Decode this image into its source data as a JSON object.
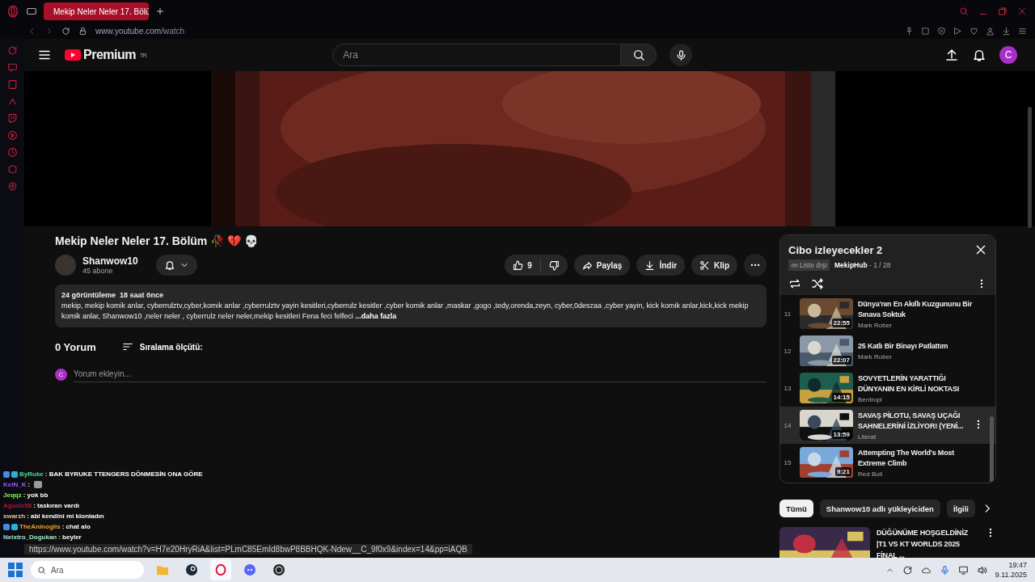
{
  "browser": {
    "tab_title": "Mekip Neler Neler 17. Bölü",
    "url_host": "www.youtube.com",
    "url_path": "/watch"
  },
  "header": {
    "logo_text": "Premium",
    "region": "TR",
    "search": {
      "placeholder": "Ara"
    },
    "avatar_letter": "C"
  },
  "video": {
    "title": "Mekip Neler Neler 17. Bölüm 🥀 💔 💀",
    "channel": "Shanwow10",
    "subscribers": "45 abone",
    "likes": "9",
    "actions": [
      {
        "kind": "share",
        "label": "Paylaş"
      },
      {
        "kind": "download",
        "label": "İndir"
      },
      {
        "kind": "clip",
        "label": "Klip"
      }
    ],
    "stats": "24 görüntüleme  18 saat önce",
    "description": "mekip, mekip komik anlar, cyberrulztv,cyber,komik anlar ,cyberrulztv yayin kesitleri,cyberrulz kesitler ,cyber komik anlar ,maskar ,gogo ,tedy,orenda,zeyn, cyber,0deszaa ,cyber yayin, kick komik anlar,kick,kick mekip komik anlar, Shanwow10 ,neler neler , cyberrulz neler neler,mekip kesitleri Fena feci felfeci ",
    "more": "...daha fazla"
  },
  "comments": {
    "count": "0 Yorum",
    "sort": "Sıralama ölçütü:",
    "placeholder": "Yorum ekleyin...",
    "avatar_letter": "C"
  },
  "playlist": {
    "title": "Cibo izleyecekler 2",
    "visibility": "Liste dışı",
    "owner": "MekipHub",
    "position": " - 1 / 28",
    "items": [
      {
        "index": "11",
        "title": "Dünya'nın En Akıllı Kuzgununu Bir Sınava Soktuk",
        "channel": "Mark Rober",
        "duration": "22:55",
        "selected": false
      },
      {
        "index": "12",
        "title": "25 Katlı Bir Binayı Patlattım",
        "channel": "Mark Rober",
        "duration": "22:07",
        "selected": false
      },
      {
        "index": "13",
        "title": "SOVYETLERİN YARATTIĞI DÜNYANIN EN KİRLİ NOKTASI",
        "channel": "Bentropi",
        "duration": "14:15",
        "selected": false
      },
      {
        "index": "14",
        "title": "SAVAŞ PİLOTU, SAVAŞ UÇAĞI SAHNELERİNİ İZLİYOR! (YENİ...",
        "channel": "Literat",
        "duration": "13:59",
        "selected": true
      },
      {
        "index": "15",
        "title": "Attempting The World's Most Extreme Climb",
        "channel": "Red Bull",
        "duration": "9:21",
        "selected": false
      }
    ]
  },
  "chips": [
    {
      "label": "Tümü",
      "selected": true
    },
    {
      "label": "Shanwow10 adlı yükleyiciden",
      "selected": false
    },
    {
      "label": "İlgili",
      "selected": false
    }
  ],
  "recommended": [
    {
      "title": "DÜĞÜNÜME HOŞGELDİNİZ |T1 VS KT WORLDS 2025 FİNAL ..."
    }
  ],
  "chat": [
    {
      "user": "ByRuke",
      "color": "#3ddc97",
      "message": " : BAK BYRUKE TTENGERS DÖNMESİN ONA GÖRE",
      "badges": true,
      "emote": false
    },
    {
      "user": "KeiN_K",
      "color": "#9b5cff",
      "message": " :",
      "badges": false,
      "emote": true
    },
    {
      "user": "Jeqqz",
      "color": "#7cfc4a",
      "message": " : yok bb",
      "badges": false,
      "emote": false
    },
    {
      "user": "Aguzle58",
      "color": "#b0163c",
      "message": " : taskıran vardı",
      "badges": false,
      "emote": false
    },
    {
      "user": "swarzh",
      "color": "#e6c38a",
      "message": " : abi kendini mi klonladın",
      "badges": false,
      "emote": false
    },
    {
      "user": "TheAninogiis",
      "color": "#e8a23a",
      "message": " : chat alo",
      "badges": true,
      "emote": false
    },
    {
      "user": "Neixtro_Dogukan",
      "color": "#a8e6cf",
      "message": " : beyler",
      "badges": false,
      "emote": false
    }
  ],
  "status_url": "https://www.youtube.com/watch?v=H7e20HryRiA&list=PLmC85EmId8bwP8BBHQK-Ndew__C_9f0x9&index=14&pp=iAQB",
  "taskbar": {
    "search_placeholder": "Ara",
    "time": "19:47",
    "date": "9.11.2025"
  }
}
